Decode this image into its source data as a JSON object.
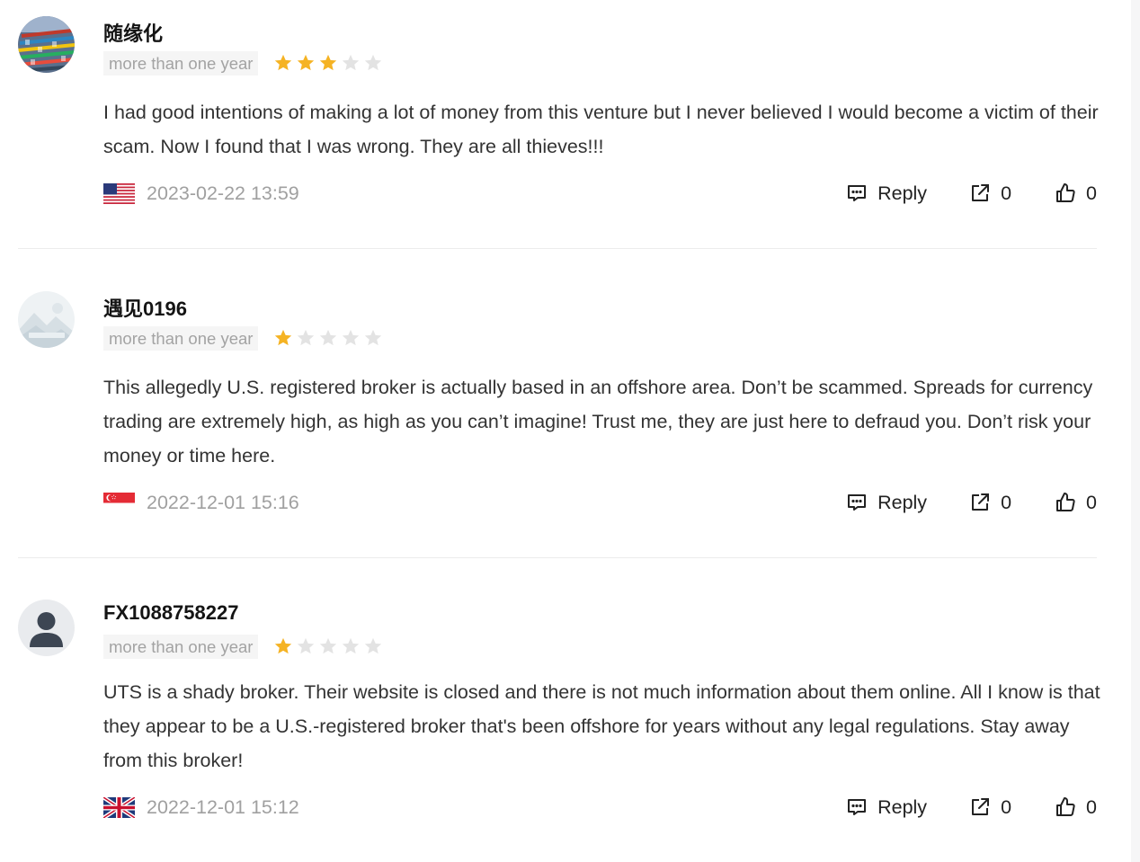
{
  "reviews": [
    {
      "author": "随缘化",
      "time_badge": "more than one year",
      "rating": 3,
      "text": "I had good intentions of making a lot of money from this venture but I never believed I would become a victim of their scam. Now I found that I was wrong. They are all thieves!!!",
      "flag": "us-flag",
      "date": "2023-02-22 13:59",
      "reply_label": "Reply",
      "share_count": "0",
      "like_count": "0"
    },
    {
      "author": "遇见0196",
      "time_badge": "more than one year",
      "rating": 1,
      "text": "This allegedly U.S. registered broker is actually based in an offshore area. Don’t be scammed. Spreads for currency trading are extremely high, as high as you can’t imagine! Trust me, they are just here to defraud you. Don’t risk your money or time here.",
      "flag": "sg-flag",
      "date": "2022-12-01 15:16",
      "reply_label": "Reply",
      "share_count": "0",
      "like_count": "0"
    },
    {
      "author": "FX1088758227",
      "time_badge": "more than one year",
      "rating": 1,
      "text": "UTS is a shady broker. Their website is closed and there is not much information about them online. All I know is that they appear to be a U.S.-registered broker that's been offshore for years without any legal regulations. Stay away from this broker!",
      "flag": "uk-flag",
      "date": "2022-12-01 15:12",
      "reply_label": "Reply",
      "share_count": "0",
      "like_count": "0"
    }
  ],
  "colors": {
    "star_on": "#f5b324",
    "star_off": "#e3e3e3",
    "divider": "#ececec",
    "muted": "#a0a0a0"
  },
  "icons": [
    "comment-icon",
    "share-icon",
    "thumbs-up-icon",
    "star-icon"
  ]
}
